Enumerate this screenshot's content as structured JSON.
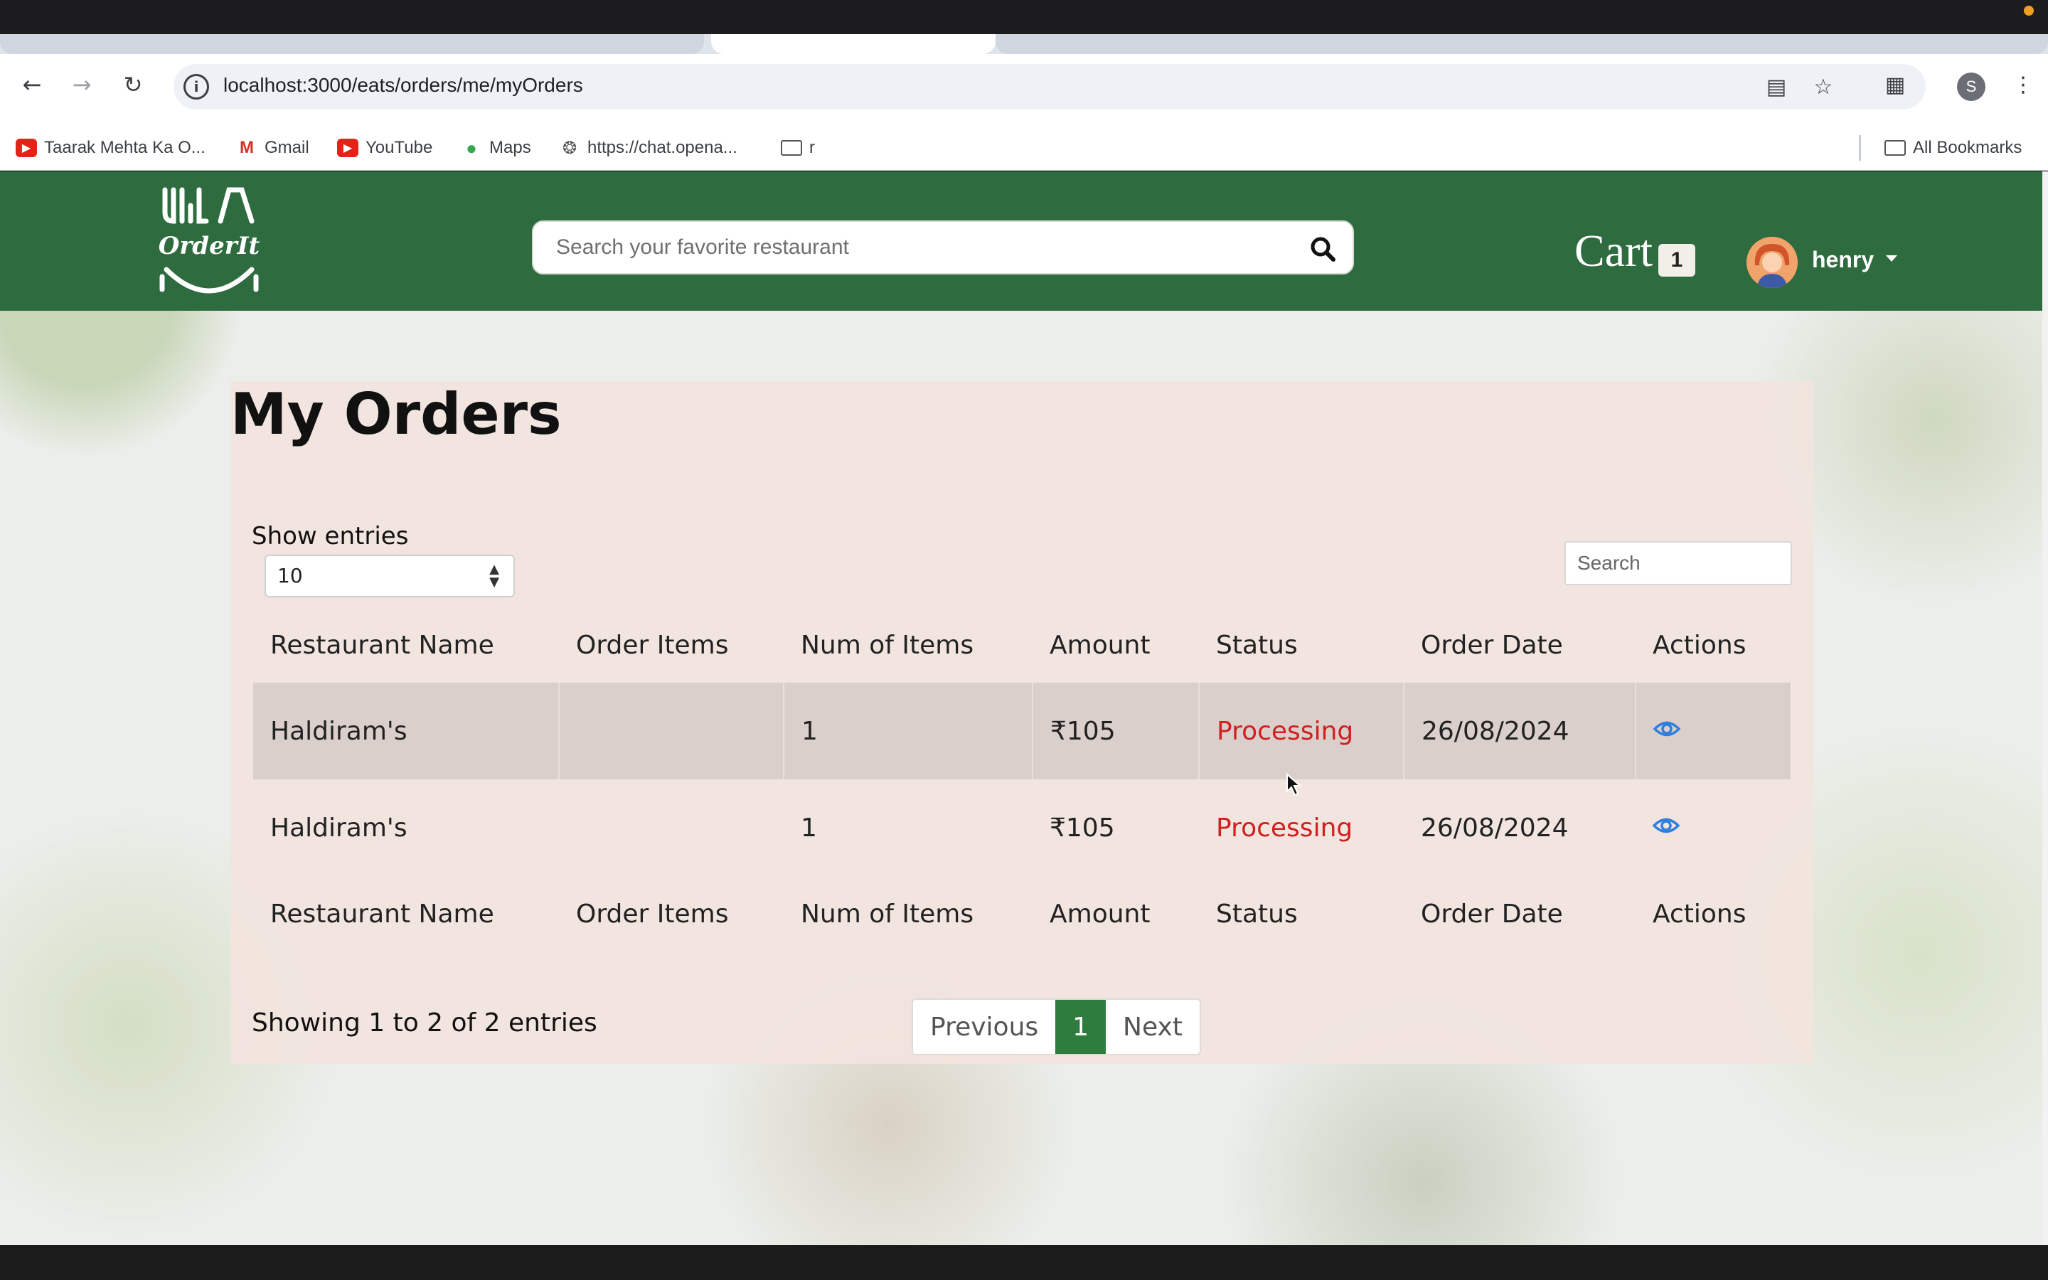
{
  "browser": {
    "url": "localhost:3000/eats/orders/me/myOrders",
    "bookmarks": [
      {
        "label": "Taarak Mehta Ka O...",
        "icon": "youtube-icon",
        "color": "#e62117"
      },
      {
        "label": "Gmail",
        "icon": "gmail-icon",
        "color": "#d93025"
      },
      {
        "label": "YouTube",
        "icon": "youtube-icon",
        "color": "#e62117"
      },
      {
        "label": "Maps",
        "icon": "maps-icon",
        "color": "#34a853"
      },
      {
        "label": "https://chat.opena...",
        "icon": "openai-icon",
        "color": "#555555"
      },
      {
        "label": "r",
        "icon": "folder-icon",
        "color": "#555555"
      }
    ],
    "all_bookmarks": "All Bookmarks",
    "profile_initial": "S"
  },
  "header": {
    "brand_color": "#2e6b3f",
    "logo_text": "OrderIt",
    "search_placeholder": "Search your favorite restaurant",
    "cart_label": "Cart",
    "cart_count": "1",
    "user_name": "henry"
  },
  "orders": {
    "title": "My Orders",
    "show_entries_label": "Show entries",
    "entries_value": "10",
    "search_placeholder": "Search",
    "columns": [
      "Restaurant Name",
      "Order Items",
      "Num of Items",
      "Amount",
      "Status",
      "Order Date",
      "Actions"
    ],
    "rows": [
      {
        "restaurant": "Haldiram's",
        "items": "",
        "num_items": "1",
        "amount": "₹105",
        "status": "Processing",
        "date": "26/08/2024"
      },
      {
        "restaurant": "Haldiram's",
        "items": "",
        "num_items": "1",
        "amount": "₹105",
        "status": "Processing",
        "date": "26/08/2024"
      }
    ],
    "status_color": "#d02020",
    "info_text": "Showing 1 to 2 of 2 entries",
    "pager": {
      "previous": "Previous",
      "current": "1",
      "next": "Next"
    }
  }
}
